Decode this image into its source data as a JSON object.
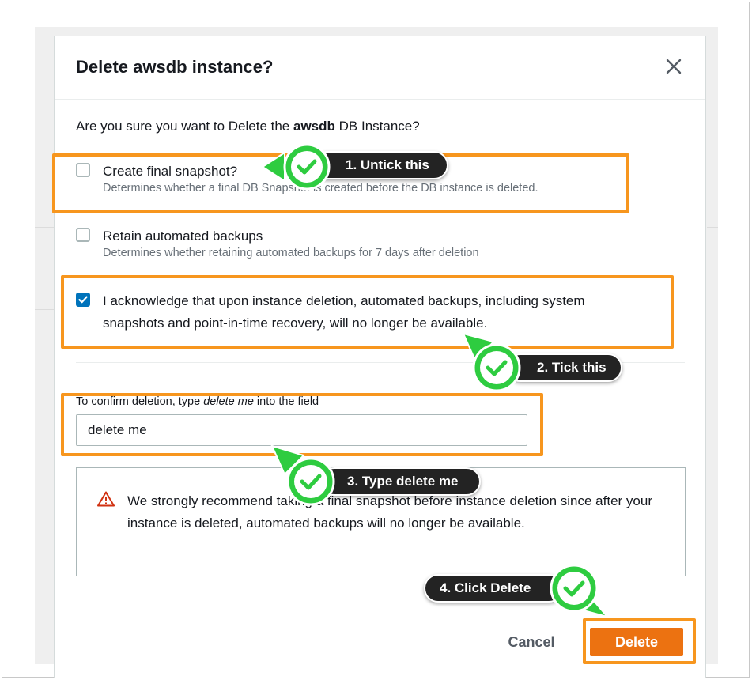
{
  "modal": {
    "title": "Delete awsdb instance?",
    "prompt_before": "Are you sure you want to Delete the ",
    "prompt_bold": "awsdb",
    "prompt_after": " DB Instance?"
  },
  "options": [
    {
      "label": "Create final snapshot?",
      "description": "Determines whether a final DB Snapshot is created before the DB instance is deleted.",
      "checked": false
    },
    {
      "label": "Retain automated backups",
      "description": "Determines whether retaining automated backups for 7 days after deletion",
      "checked": false
    },
    {
      "label_line1": "I acknowledge that upon instance deletion, automated backups, including system",
      "label_line2": "snapshots and point-in-time recovery, will no longer be available.",
      "checked": true
    }
  ],
  "confirm": {
    "label_before": "To confirm deletion, type ",
    "label_italic": "delete me",
    "label_after": " into the field",
    "value": "delete me"
  },
  "alert": {
    "icon": "warning-triangle-icon",
    "text": "We strongly recommend taking a final snapshot before instance deletion since after your instance is deleted, automated backups will no longer be available."
  },
  "footer": {
    "cancel_label": "Cancel",
    "delete_label": "Delete"
  },
  "annotations": {
    "step1": "1. Untick this",
    "step2": "2. Tick this",
    "step3": "3. Type delete me",
    "step4": "4. Click Delete"
  },
  "colors": {
    "highlight": "#f7961e",
    "badge_green": "#2ecc40",
    "delete_button": "#ec7211",
    "checkbox_checked": "#0073bb",
    "warning": "#d13212"
  }
}
